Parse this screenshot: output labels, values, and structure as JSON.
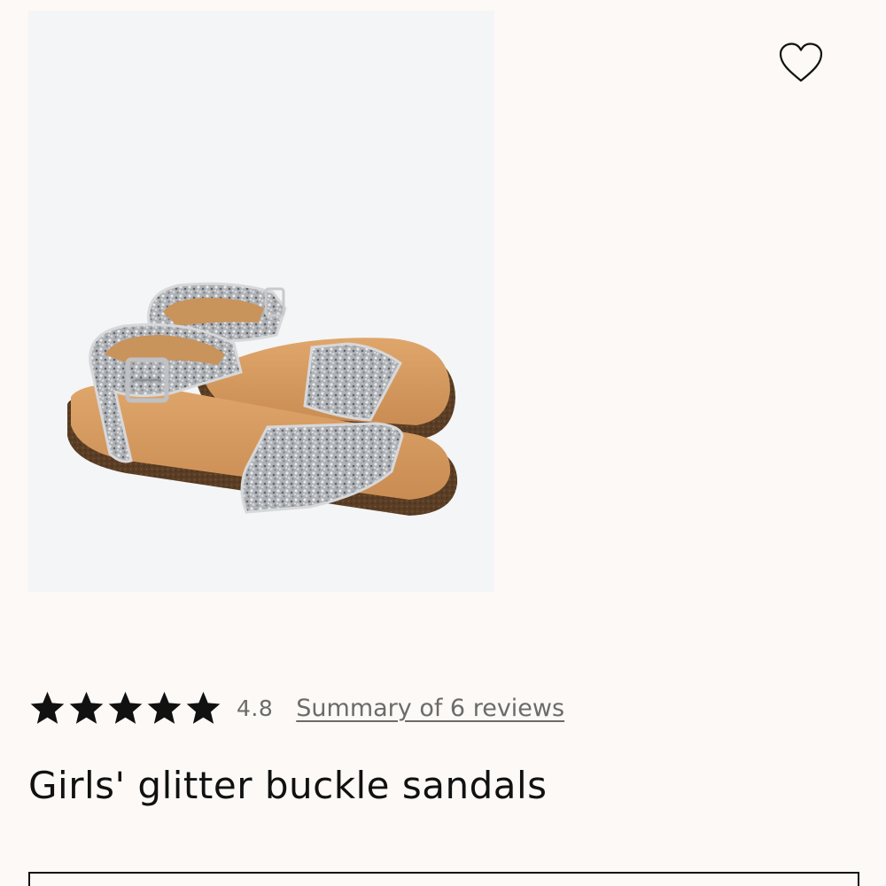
{
  "product": {
    "title": "Girls' glitter buckle sandals",
    "image_alt": "Girls' glitter buckle sandals",
    "rating": {
      "value": "4.8",
      "stars": 5,
      "reviews_link_text": "Summary of 6 reviews"
    }
  },
  "icons": {
    "wishlist": "heart-icon",
    "star": "star-icon"
  },
  "colors": {
    "background": "#fcf9f6",
    "image_background": "#f4f5f6",
    "text_primary": "#111111",
    "text_secondary": "#6b6b6b"
  }
}
